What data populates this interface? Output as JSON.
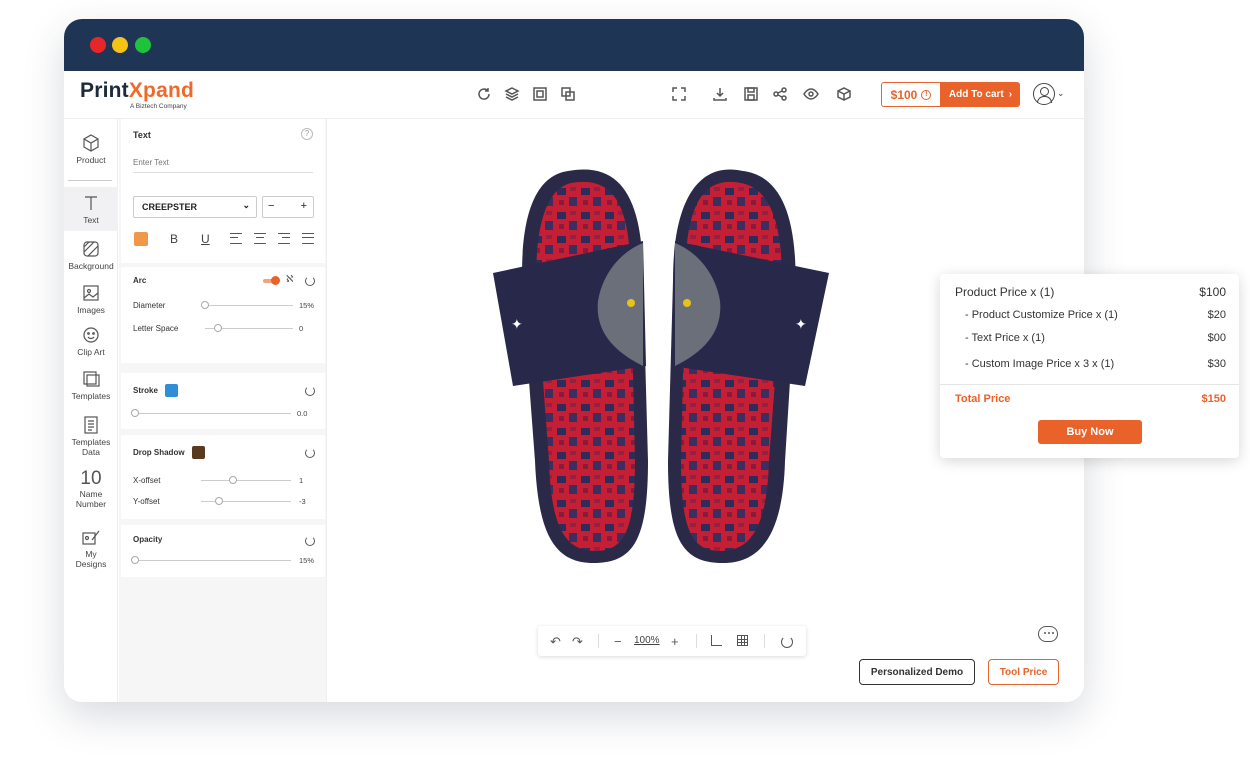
{
  "brand": {
    "name_part1": "Print",
    "name_part2": "Xpand",
    "tagline": "A Biztech Company"
  },
  "toolbar": {
    "price": "$100",
    "add_to_cart": "Add To cart",
    "left_icons": [
      "refresh-icon",
      "layers-icon",
      "resize-icon",
      "duplicate-icon"
    ],
    "right_icons": [
      "fullscreen-icon",
      "download-icon",
      "save-icon",
      "share-icon",
      "preview-icon",
      "3d-view-icon"
    ]
  },
  "sidebar": {
    "items": [
      {
        "label": "Product",
        "icon": "cube-icon"
      },
      {
        "label": "Text",
        "icon": "text-icon"
      },
      {
        "label": "Background",
        "icon": "background-icon"
      },
      {
        "label": "Images",
        "icon": "image-icon"
      },
      {
        "label": "Clip Art",
        "icon": "smiley-icon"
      },
      {
        "label": "Templates",
        "icon": "templates-icon"
      },
      {
        "label": "Templates Data",
        "icon": "template-data-icon"
      },
      {
        "label": "Name Number",
        "icon": "name-number-icon",
        "glyph": "10"
      },
      {
        "label": "My Designs",
        "icon": "my-designs-icon"
      }
    ],
    "active": "Text"
  },
  "text_panel": {
    "title": "Text",
    "placeholder": "Enter Text",
    "font": "CREEPSTER",
    "size_minus": "−",
    "size_plus": "+",
    "color": "#f0974a",
    "bold": "B",
    "underline": "U",
    "arc": {
      "label": "Arc",
      "diameter_label": "Diameter",
      "diameter_value": "15%",
      "diameter_level": 0.0,
      "letter_space_label": "Letter Space",
      "letter_space_value": "0",
      "letter_space_level": 0.15
    },
    "stroke": {
      "label": "Stroke",
      "color": "#2f8fd6",
      "value": "0.0",
      "level": 0.0
    },
    "drop_shadow": {
      "label": "Drop Shadow",
      "color": "#5a3a1e",
      "x_label": "X-offset",
      "x_value": "1",
      "x_level": 0.35,
      "y_label": "Y-offset",
      "y_value": "-3",
      "y_level": 0.2
    },
    "opacity": {
      "label": "Opacity",
      "value": "15%",
      "level": 0.0
    }
  },
  "zoom": {
    "undo": "↶",
    "redo": "↷",
    "minus": "−",
    "value": "100%",
    "plus": "+"
  },
  "buttons": {
    "demo": "Personalized Demo",
    "tool_price": "Tool Price"
  },
  "price_popup": {
    "rows": [
      {
        "label": "Product Price  x  (1)",
        "amount": "$100"
      },
      {
        "label": "- Product Customize Price  x  (1)",
        "amount": "$20"
      },
      {
        "label": "- Text Price x (1)",
        "amount": "$00"
      },
      {
        "label": "- Custom Image Price x 3 x  (1)",
        "amount": "$30"
      }
    ],
    "total_label": "Total Price",
    "total_amount": "$150",
    "buy_now": "Buy Now"
  },
  "colors": {
    "accent": "#e8622a",
    "titlebar": "#1f3555",
    "dot_red": "#e8262a",
    "dot_yellow": "#f6c218",
    "dot_green": "#1fc23b"
  }
}
